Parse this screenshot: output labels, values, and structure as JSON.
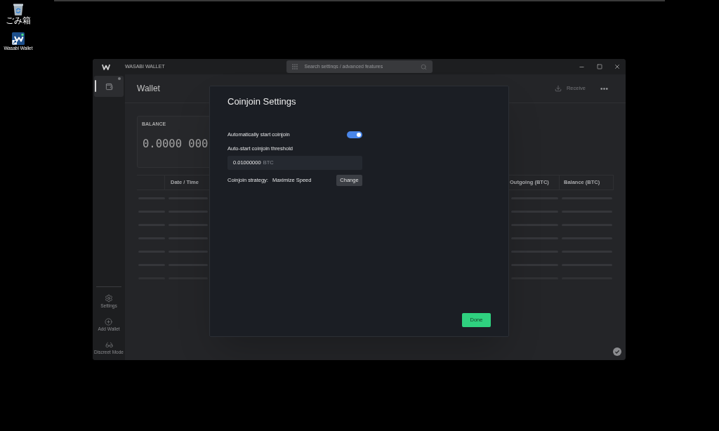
{
  "desktop": {
    "icons": [
      {
        "kind": "trash",
        "label": "ごみ箱"
      },
      {
        "kind": "app",
        "label": "Wasabi Wallet"
      }
    ]
  },
  "window": {
    "title": "WASABI WALLET",
    "search": {
      "placeholder": "Search settings / advanced features"
    }
  },
  "sidebar": {
    "wallets": [
      {
        "selected": true
      }
    ],
    "items": [
      {
        "kind": "settings",
        "label": "Settings"
      },
      {
        "kind": "add",
        "label": "Add Wallet"
      },
      {
        "kind": "discreet",
        "label": "Discreet Mode"
      }
    ]
  },
  "wallet": {
    "title": "Wallet",
    "actions": [
      {
        "kind": "receive",
        "label": "Receive"
      },
      {
        "kind": "more"
      }
    ],
    "balance": {
      "label": "BALANCE",
      "value": "0.0000 000"
    },
    "transactions": {
      "columns": [
        {
          "label": "Date / Time"
        },
        {
          "label": "Outgoing (BTC)"
        },
        {
          "label": "Balance (BTC)"
        }
      ],
      "loading": true
    }
  },
  "dialog": {
    "title": "Coinjoin Settings",
    "auto_start": {
      "label": "Automatically start coinjoin",
      "on": true
    },
    "threshold": {
      "label": "Auto-start coinjoin threshold",
      "value": "0.01000000",
      "unit": "BTC"
    },
    "strategy": {
      "label": "Coinjoin strategy:",
      "value": "Maximize Speed",
      "button": "Change"
    },
    "done": "Done"
  }
}
